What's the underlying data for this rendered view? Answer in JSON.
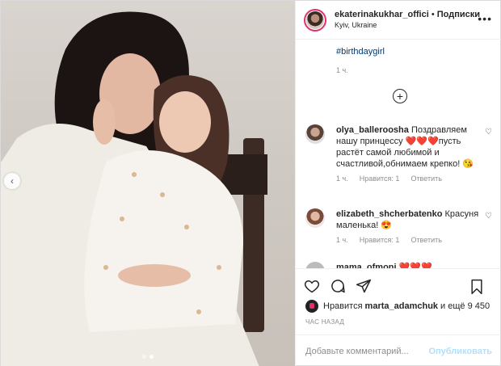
{
  "header": {
    "username": "ekaterinakukhar_offici",
    "separator": "•",
    "follow_label": "Подписки",
    "location": "Kyiv, Ukraine",
    "more_icon": "more-dots-icon"
  },
  "caption": {
    "hashtag": "#birthdaygirl",
    "time_ago": "1 ч."
  },
  "comments": [
    {
      "username": "olya_balleroosha",
      "text": "Поздравляем нашу принцессу ❤️❤️❤️пусть растёт самой любимой и счастливой,обнимаем крепко! 😘",
      "time_ago": "1 ч.",
      "likes": "Нравится: 1",
      "reply": "Ответить"
    },
    {
      "username": "elizabeth_shcherbatenko",
      "text": "Красуня маленька! 😍",
      "time_ago": "1 ч.",
      "likes": "Нравится: 1",
      "reply": "Ответить"
    },
    {
      "username": "mama_ofmoni",
      "text": "❤️❤️❤️"
    }
  ],
  "likes": {
    "prefix": "Нравится",
    "user": "marta_adamchuk",
    "suffix": "и ещё 9 450"
  },
  "timestamp": "ЧАС НАЗАД",
  "add_comment": {
    "placeholder": "Добавьте комментарий...",
    "publish_label": "Опубликовать"
  },
  "colors": {
    "link": "#00376b",
    "muted": "#8e8e8e",
    "publish_disabled": "#b2dffc",
    "story_ring": "#e1306c"
  }
}
